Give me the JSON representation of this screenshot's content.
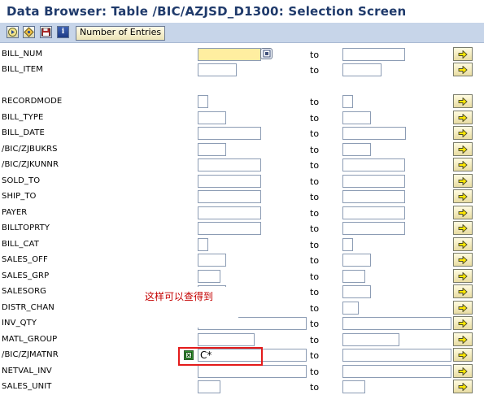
{
  "window": {
    "title": "Data Browser: Table /BIC/AZJSD_D1300: Selection Screen"
  },
  "toolbar": {
    "execute_icon": "execute-icon",
    "variant_icon": "variant-icon",
    "save_icon": "save-icon",
    "info_icon": "info-icon",
    "number_of_entries_label": "Number of Entries"
  },
  "colors": {
    "title_text": "#1f3a6b",
    "toolbar_bg": "#c7d5e9",
    "required_field_bg": "#ffeea0",
    "highlight_border": "#e41b1b",
    "annotation_text": "#c40000"
  },
  "range_separator": "to",
  "fields": [
    {
      "name": "BILL_NUM",
      "low": "",
      "high": ""
    },
    {
      "name": "BILL_ITEM",
      "low": "",
      "high": ""
    },
    {
      "name": "RECORDMODE",
      "low": "",
      "high": ""
    },
    {
      "name": "BILL_TYPE",
      "low": "",
      "high": ""
    },
    {
      "name": "BILL_DATE",
      "low": "",
      "high": ""
    },
    {
      "name": "/BIC/ZJBUKRS",
      "low": "",
      "high": ""
    },
    {
      "name": "/BIC/ZJKUNNR",
      "low": "",
      "high": ""
    },
    {
      "name": "SOLD_TO",
      "low": "",
      "high": ""
    },
    {
      "name": "SHIP_TO",
      "low": "",
      "high": ""
    },
    {
      "name": "PAYER",
      "low": "",
      "high": ""
    },
    {
      "name": "BILLTOPRTY",
      "low": "",
      "high": ""
    },
    {
      "name": "BILL_CAT",
      "low": "",
      "high": ""
    },
    {
      "name": "SALES_OFF",
      "low": "",
      "high": ""
    },
    {
      "name": "SALES_GRP",
      "low": "",
      "high": ""
    },
    {
      "name": "SALESORG",
      "low": "",
      "high": ""
    },
    {
      "name": "DISTR_CHAN",
      "low": "",
      "high": ""
    },
    {
      "name": "INV_QTY",
      "low": "",
      "high": ""
    },
    {
      "name": "MATL_GROUP",
      "low": "",
      "high": ""
    },
    {
      "name": "/BIC/ZJMATNR",
      "low": "C*",
      "high": ""
    },
    {
      "name": "NETVAL_INV",
      "low": "",
      "high": ""
    },
    {
      "name": "SALES_UNIT",
      "low": "",
      "high": ""
    }
  ],
  "annotation": {
    "text": "这样可以查得到"
  },
  "icons": {
    "multiple_selection": "multiple-selection-arrow-icon",
    "search_help": "search-help-icon",
    "selection_option": "selection-option-icon"
  }
}
